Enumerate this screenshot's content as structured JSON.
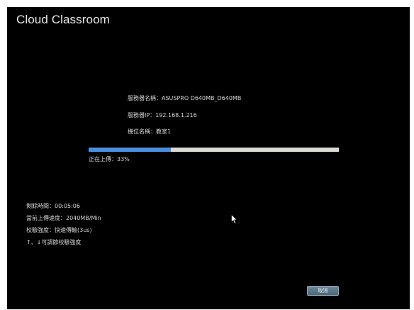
{
  "app": {
    "title": "Cloud Classroom"
  },
  "server_info": {
    "server_name": "服務器名稱：ASUSPRO D640MB_D640MB",
    "server_ip": "服務器IP：192.168.1.216",
    "classroom_name": "機位名稱：教室1"
  },
  "progress": {
    "percent": 33,
    "label": "正在上傳：33%",
    "fill_color": "#4a90e2",
    "track_color": "#dcdcd6"
  },
  "stats": {
    "elapsed": "剩餘時間：00:05:06",
    "speed": "當前上傳速度：2040MB/Min",
    "verify_strength": "校驗強度：快速傳輸(3us)",
    "hint": "↑、↓可調節校驗強度"
  },
  "buttons": {
    "cancel_label": "取消"
  },
  "icons": {
    "cursor": "mouse-pointer-icon"
  },
  "colors": {
    "background": "#000000",
    "text": "#d6d6d6"
  }
}
